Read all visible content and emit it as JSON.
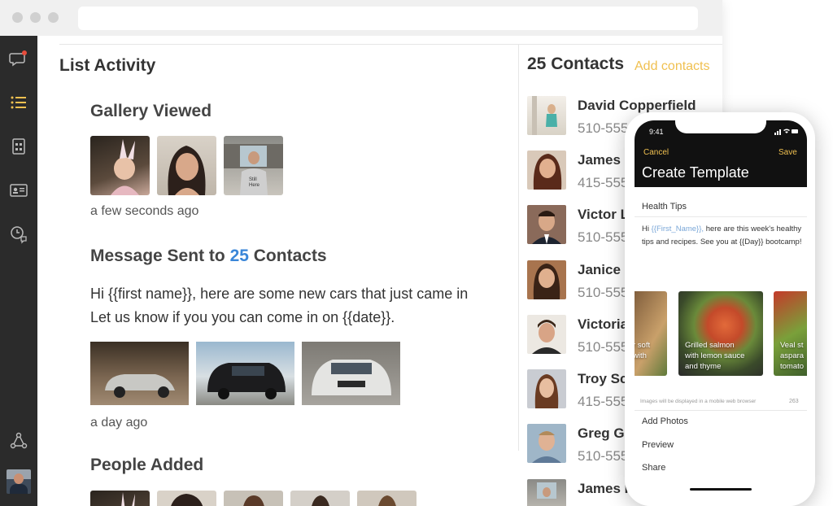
{
  "list_activity": {
    "title": "List Activity",
    "gallery": {
      "title": "Gallery Viewed",
      "time": "a few seconds ago"
    },
    "message": {
      "title_prefix": "Message Sent to",
      "count": "25",
      "title_suffix": "Contacts",
      "line1": "Hi {{first name}}, here are some new cars that just came in",
      "line2": "Let us know if you you can come in on {{date}}.",
      "time": "a day ago"
    },
    "people": {
      "title": "People Added"
    }
  },
  "contacts": {
    "title": "25 Contacts",
    "add_label": "Add contacts",
    "items": [
      {
        "name": "David Copperfield",
        "phone": "510-555"
      },
      {
        "name": "James F",
        "phone": "415-555"
      },
      {
        "name": "Victor L",
        "phone": "510-555"
      },
      {
        "name": "Janice C",
        "phone": "510-555"
      },
      {
        "name": "Victoria",
        "phone": "510-555"
      },
      {
        "name": "Troy Sca",
        "phone": "415-555"
      },
      {
        "name": "Greg Ga",
        "phone": "510-555"
      },
      {
        "name": "James F",
        "phone": ""
      }
    ]
  },
  "phone": {
    "time": "9:41",
    "cancel": "Cancel",
    "save": "Save",
    "title": "Create Template",
    "field": "Health Tips",
    "body": {
      "hi": "Hi",
      "token1": "{{First_Name}},",
      "text1": "here are this week's healthy tips and recipes. See you at {{Day}} bootcamp!"
    },
    "foods": [
      {
        "line1": "r soft",
        "line2": "with",
        "line3": ""
      },
      {
        "line1": "Grilled salmon",
        "line2": "with lemon sauce",
        "line3": "and thyme"
      },
      {
        "line1": "Veal st",
        "line2": "aspara",
        "line3": "tomato"
      }
    ],
    "note": "Images will be displayed in a mobile web browser",
    "count": "263",
    "menu": [
      "Add Photos",
      "Preview",
      "Share"
    ]
  },
  "colors": {
    "accent_blue": "#3a86d8",
    "accent_yellow": "#f0c050",
    "sidebar": "#2b2b2b"
  }
}
